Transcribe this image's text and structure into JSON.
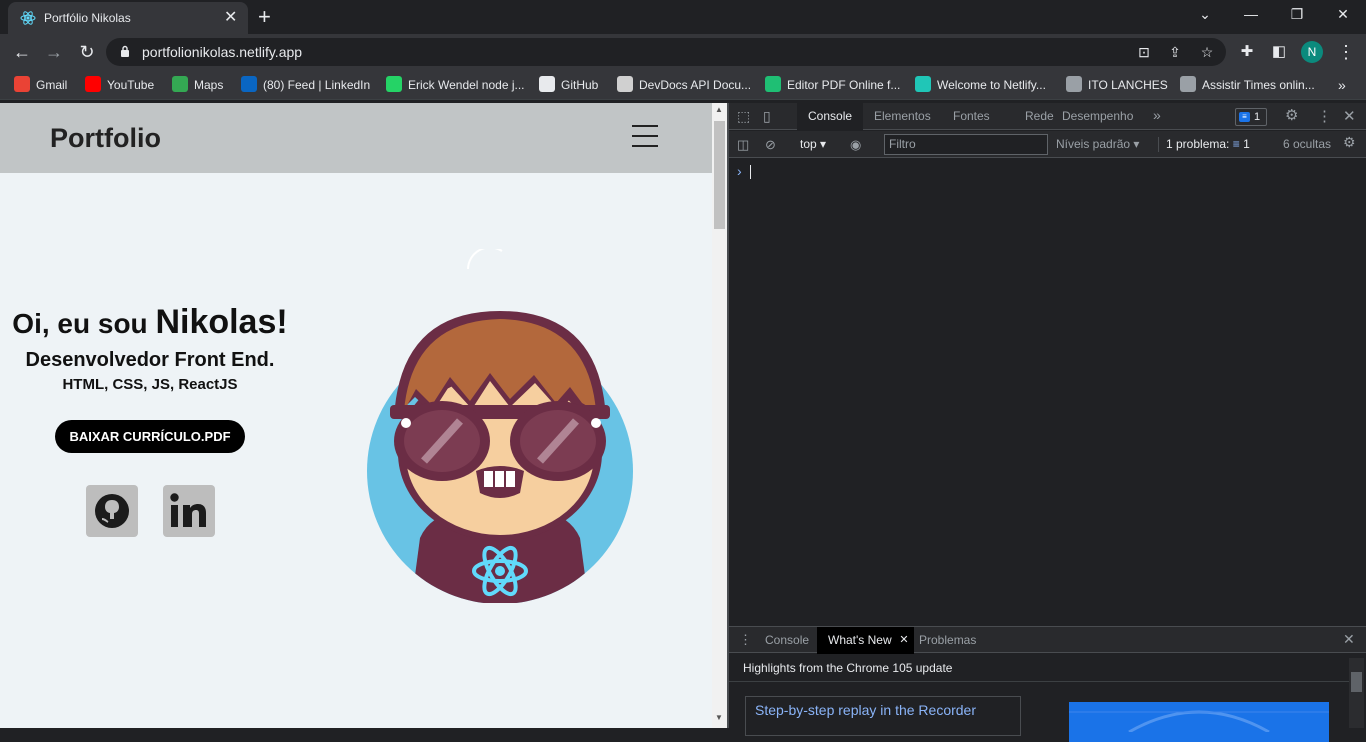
{
  "browser": {
    "tab_title": "Portfólio Nikolas",
    "tab_close": "✕",
    "new_tab": "+",
    "url": "portfolionikolas.netlify.app",
    "profile_initial": "N",
    "window_controls": {
      "minimize": "—",
      "restore": "❐",
      "close": "✕",
      "tab_search": "⌄"
    },
    "bookmarks": [
      {
        "label": "Gmail",
        "color": "#ea4335"
      },
      {
        "label": "YouTube",
        "color": "#ff0000"
      },
      {
        "label": "Maps",
        "color": "#34a853"
      },
      {
        "label": "(80) Feed | LinkedIn",
        "color": "#0a66c2"
      },
      {
        "label": "Erick Wendel node j...",
        "color": "#25d366"
      },
      {
        "label": "GitHub",
        "color": "#e8eaed"
      },
      {
        "label": "DevDocs API Docu...",
        "color": "#d0d0d0"
      },
      {
        "label": "Editor PDF Online f...",
        "color": "#1fbf74"
      },
      {
        "label": "Welcome to Netlify...",
        "color": "#20c6b7"
      },
      {
        "label": "ITO LANCHES",
        "color": "#9aa0a6"
      },
      {
        "label": "Assistir Times onlin...",
        "color": "#9aa0a6"
      }
    ],
    "bookmarks_more": "»"
  },
  "site": {
    "logo": "Portfolio",
    "hero_prefix": "Oi, eu sou ",
    "hero_name": "Nikolas!",
    "subtitle": "Desenvolvedor Front End.",
    "tech": "HTML, CSS, JS, ReactJS",
    "cv_button": "BAIXAR CURRÍCULO.PDF"
  },
  "devtools": {
    "tabs": [
      "Console",
      "Elementos",
      "Fontes",
      "Rede",
      "Desempenho"
    ],
    "more_tabs": "»",
    "issues_count": "1",
    "context": "top",
    "filter_placeholder": "Filtro",
    "levels": "Níveis padrão",
    "problems_label": "1 problema:",
    "problems_count": "1",
    "hidden": "6 ocultas",
    "prompt": "›",
    "drawer_tabs": [
      "Console",
      "What's New",
      "Problemas"
    ],
    "drawer_close": "✕",
    "drawer_tab_close": "✕",
    "whats_new_heading": "Highlights from the Chrome 105 update",
    "whats_new_item": "Step-by-step replay in the Recorder"
  }
}
